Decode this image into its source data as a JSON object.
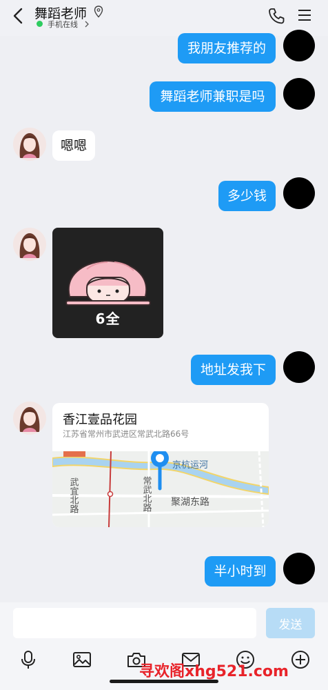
{
  "header": {
    "title": "舞蹈老师",
    "status": "手机在线",
    "back_icon": "chevron-left-icon",
    "location_icon": "location-pin-icon",
    "phone_icon": "phone-icon",
    "menu_icon": "menu-icon"
  },
  "messages": [
    {
      "from": "me",
      "text": "我朋友推荐的"
    },
    {
      "from": "me",
      "text": "舞蹈老师兼职是吗"
    },
    {
      "from": "peer",
      "text": "嗯嗯"
    },
    {
      "from": "me",
      "text": "多少钱"
    },
    {
      "from": "peer",
      "type": "image",
      "caption": "6全"
    },
    {
      "from": "me",
      "text": "地址发我下"
    },
    {
      "from": "peer",
      "type": "location",
      "title": "香江壹品花园",
      "address": "江苏省常州市武进区常武北路66号",
      "map_labels": {
        "canal": "京杭运河",
        "road_east": "聚湖东路",
        "road_changwu": "常武北路",
        "road_wuyi": "武宜北路"
      }
    },
    {
      "from": "me",
      "text": "半小时到"
    }
  ],
  "input": {
    "value": "",
    "send_label": "发送"
  },
  "toolbar": {
    "icons": [
      "microphone-icon",
      "image-icon",
      "camera-icon",
      "envelope-icon",
      "emoji-icon",
      "add-icon"
    ]
  },
  "watermark": "寻欢阁xhg521.com",
  "colors": {
    "outgoing_bubble": "#1e9bf5",
    "incoming_bubble": "#ffffff",
    "background": "#eeeff3",
    "send_button_disabled": "#b7dcf6",
    "online_dot": "#2ecc60",
    "watermark": "#e8232a"
  }
}
